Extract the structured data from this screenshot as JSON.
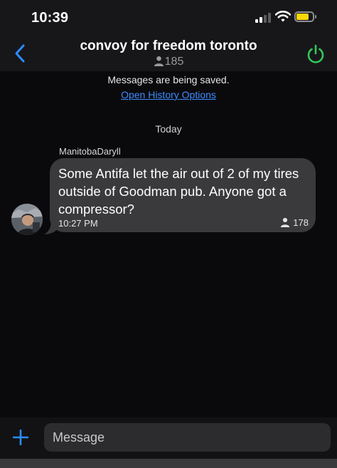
{
  "status_bar": {
    "time": "10:39",
    "signal_icon": "cellular-signal-icon",
    "wifi_icon": "wifi-icon",
    "battery_icon": "battery-icon",
    "battery_level": 0.75,
    "battery_color": "#ffd60a"
  },
  "header": {
    "back_icon": "chevron-left-icon",
    "title": "convoy for freedom toronto",
    "member_icon": "person-icon",
    "member_count": "185",
    "power_icon": "power-icon",
    "accent": "#2d8cff",
    "power_color": "#34c759"
  },
  "notice": {
    "saved_text": "Messages are being saved.",
    "history_link": "Open History Options"
  },
  "date_divider": "Today",
  "messages": [
    {
      "sender": "ManitobaDaryll",
      "text": "Some Antifa let the air out of 2 of my tires outside of Goodman pub. Anyone got a compressor?",
      "time": "10:27 PM",
      "read_icon": "person-icon",
      "read_count": "178"
    }
  ],
  "composer": {
    "add_icon": "plus-icon",
    "placeholder": "Message"
  }
}
